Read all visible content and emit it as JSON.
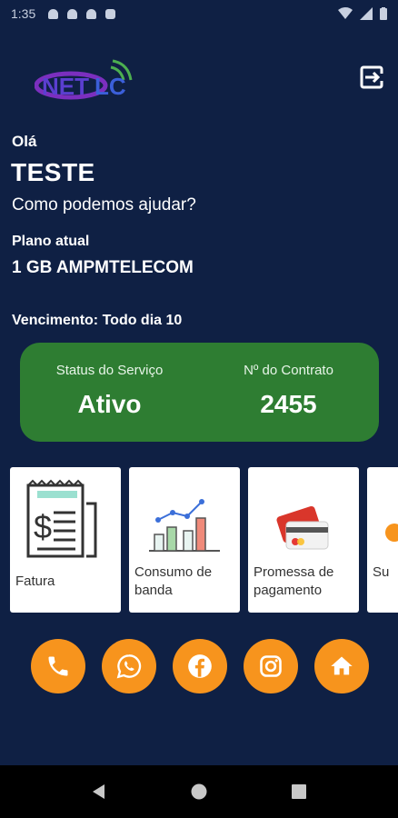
{
  "status_bar": {
    "time": "1:35",
    "icons": [
      "notification-icon",
      "notification-icon",
      "notification-icon",
      "app-icon",
      "wifi-icon",
      "signal-icon",
      "battery-icon"
    ]
  },
  "header": {
    "logo_text": "NETLC",
    "logout_icon": "logout-icon"
  },
  "greeting": {
    "hello": "Olá",
    "name": "TESTE",
    "help": "Como podemos ajudar?"
  },
  "plan": {
    "label": "Plano atual",
    "name": "1 GB AMPMTELECOM"
  },
  "due_date": "Vencimento: Todo dia 10",
  "status_card": {
    "service_label": "Status do Serviço",
    "service_value": "Ativo",
    "contract_label": "Nº do Contrato",
    "contract_value": "2455",
    "color": "#2e7d32"
  },
  "tiles": [
    {
      "label": "Fatura",
      "icon": "invoice-icon"
    },
    {
      "label": "Consumo de banda",
      "icon": "bandwidth-chart-icon"
    },
    {
      "label": "Promessa de pagamento",
      "icon": "payment-cards-icon"
    },
    {
      "label": "Su",
      "icon": "support-icon"
    }
  ],
  "socials": [
    {
      "name": "phone",
      "icon": "phone-icon"
    },
    {
      "name": "whatsapp",
      "icon": "whatsapp-icon"
    },
    {
      "name": "facebook",
      "icon": "facebook-icon"
    },
    {
      "name": "instagram",
      "icon": "instagram-icon"
    },
    {
      "name": "home",
      "icon": "home-icon"
    }
  ],
  "colors": {
    "background": "#0f2044",
    "accent": "#f7941d",
    "card": "#2e7d32"
  },
  "nav": [
    "back-icon",
    "home-nav-icon",
    "recents-icon"
  ]
}
